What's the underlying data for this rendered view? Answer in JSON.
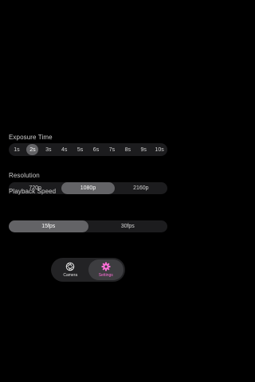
{
  "sections": {
    "exposure": {
      "title": "Exposure Time",
      "options": [
        "1s",
        "2s",
        "3s",
        "4s",
        "5s",
        "6s",
        "7s",
        "8s",
        "9s",
        "10s"
      ],
      "selected": "2s"
    },
    "resolution": {
      "title": "Resolution",
      "options": [
        "720p",
        "1080p",
        "2160p"
      ],
      "selected": "1080p"
    },
    "playback": {
      "title": "Playback Speed",
      "options": [
        "15fps",
        "30fps"
      ],
      "selected": "15fps"
    }
  },
  "tabbar": {
    "tabs": [
      {
        "label": "Camera",
        "icon": "aperture-icon",
        "active": false
      },
      {
        "label": "Settings",
        "icon": "gear-icon",
        "active": true
      }
    ]
  },
  "colors": {
    "background": "#000000",
    "segment_background": "#1c1c1e",
    "segment_selected": "#636366",
    "accent": "#ff6fd8"
  }
}
